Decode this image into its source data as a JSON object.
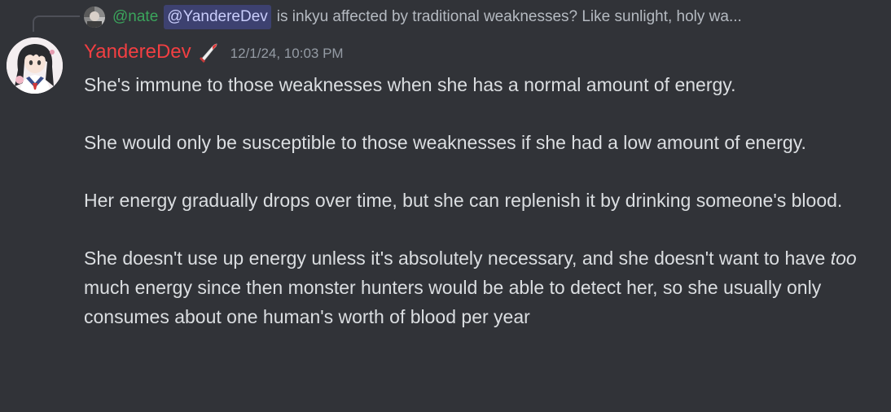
{
  "reply": {
    "author": "@nate",
    "mention": "@YandereDev",
    "text": "is inkyu affected by traditional weaknesses? Like sunlight, holy wa..."
  },
  "message": {
    "author": "YandereDev",
    "timestamp": "12/1/24, 10:03 PM",
    "role_icon": "knife-icon",
    "paragraphs": {
      "p1": "She's immune to those weaknesses when she has a normal amount of energy.",
      "p2": "She would only be susceptible to those weaknesses if she had a low amount of energy.",
      "p3": "Her energy gradually drops over time, but she can replenish it by drinking someone's blood.",
      "p4_before": "She doesn't use up energy unless it's absolutely necessary, and she doesn't want to have ",
      "p4_emphasis": "too",
      "p4_after": " much energy since then monster hunters would be able to detect her, so she usually only consumes about one human's worth of blood per year"
    }
  },
  "colors": {
    "background": "#313338",
    "username": "#f23f42",
    "reply_author": "#3ba55c",
    "mention_bg": "#3c4270",
    "text": "#dbdee1",
    "muted": "#949ba4"
  }
}
